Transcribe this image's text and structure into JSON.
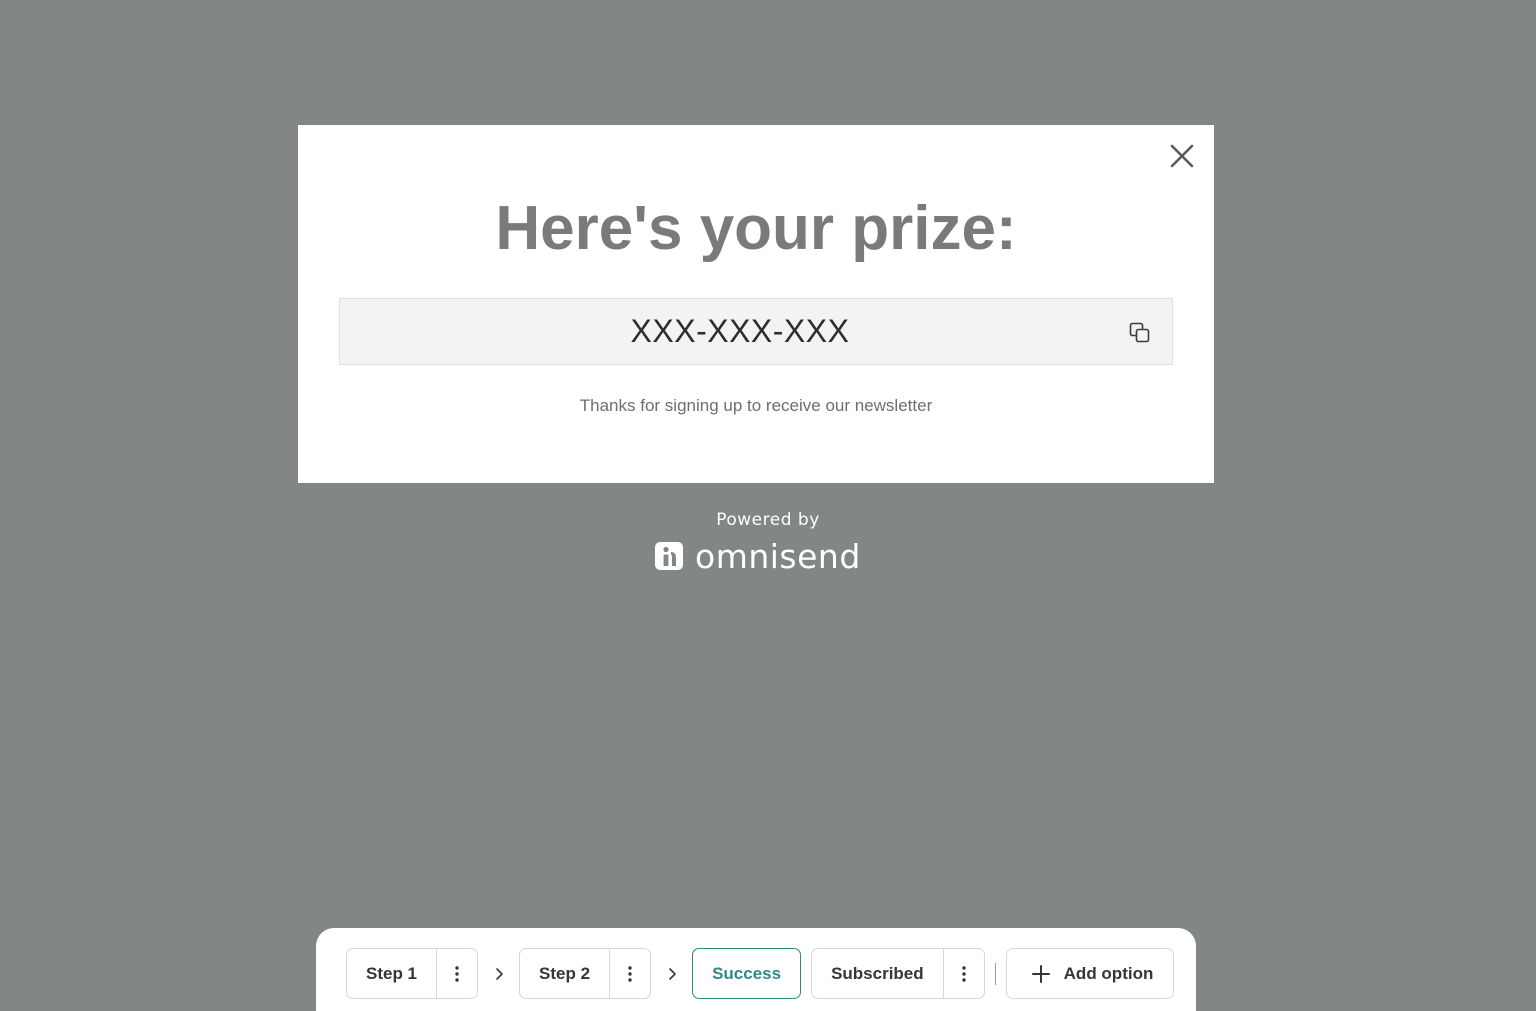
{
  "popup": {
    "title": "Here's your prize:",
    "code": "XXX-XXX-XXX",
    "thanks_text": "Thanks for signing up to receive our newsletter",
    "close_icon": "close-icon",
    "copy_icon": "copy-icon"
  },
  "branding": {
    "powered_by": "Powered by",
    "brand_name": "omnisend",
    "logo_icon": "omnisend-logo-icon"
  },
  "stepbar": {
    "steps": [
      {
        "label": "Step 1"
      },
      {
        "label": "Step 2"
      }
    ],
    "success_label": "Success",
    "subscribed_label": "Subscribed",
    "add_option_label": "Add option",
    "accent_color": "#2f8a86"
  },
  "colors": {
    "backdrop": "#838686",
    "popup_bg": "#ffffff",
    "title": "#7a7a7a",
    "code_bg": "#f3f3f3"
  }
}
